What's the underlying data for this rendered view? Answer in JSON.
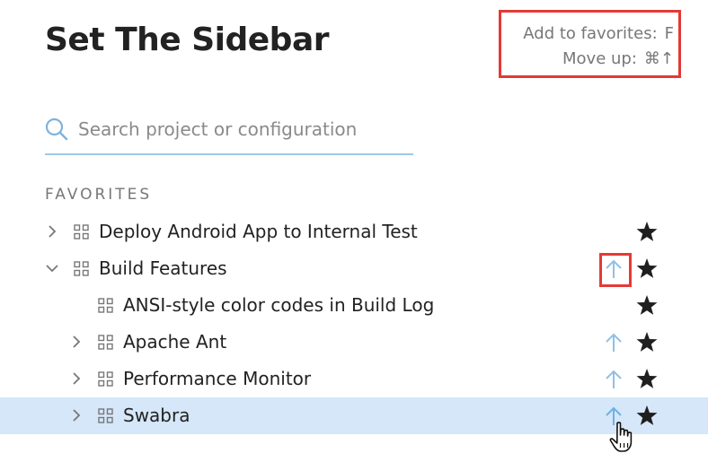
{
  "header": {
    "title": "Set The Sidebar"
  },
  "shortcuts": [
    {
      "label": "Add to favorites:",
      "key": "F"
    },
    {
      "label": "Move up:",
      "key": "⌘↑"
    }
  ],
  "search": {
    "value": "",
    "placeholder": "Search project or configuration"
  },
  "favorites": {
    "section_label": "FAVORITES",
    "items": [
      {
        "label": "Deploy Android App to Internal Test",
        "chevron": "right",
        "starred": true,
        "move_up_visible": false
      },
      {
        "label": "Build Features",
        "chevron": "down",
        "starred": true,
        "move_up_visible": true
      },
      {
        "label": "ANSI-style color codes in Build Log",
        "chevron": "none",
        "starred": true,
        "move_up_visible": false
      },
      {
        "label": "Apache Ant",
        "chevron": "right",
        "starred": true,
        "move_up_visible": true
      },
      {
        "label": "Performance Monitor",
        "chevron": "right",
        "starred": true,
        "move_up_visible": true
      },
      {
        "label": "Swabra",
        "chevron": "right",
        "starred": true,
        "move_up_visible": true,
        "hovered": true
      }
    ]
  },
  "icons": {
    "search": "search-icon",
    "chevron_right": "chevron-right-icon",
    "chevron_down": "chevron-down-icon",
    "project": "project-grid-icon",
    "move_up": "arrow-up-icon",
    "star": "star-icon",
    "cursor": "hand-pointer-icon"
  },
  "colors": {
    "highlight_row": "#d5e7f8",
    "accent_blue": "#9ec7e8",
    "annotation_red": "#e53935",
    "star": "#1f1f1f"
  }
}
